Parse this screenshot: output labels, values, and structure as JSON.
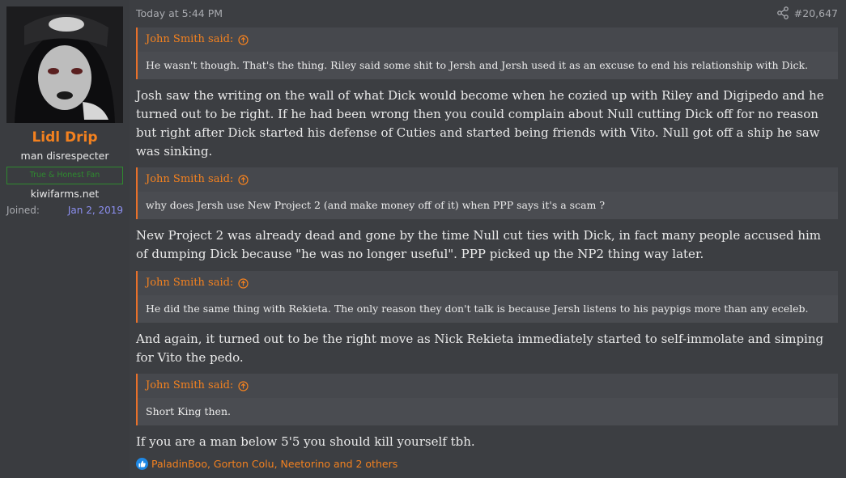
{
  "user": {
    "avatar_icon": "avatar-image",
    "name": "Lidl Drip",
    "title": "man disrespecter",
    "banner": "True & Honest Fan",
    "site": "kiwifarms.net",
    "joined_label": "Joined:",
    "joined_value": "Jan 2, 2019"
  },
  "post": {
    "timestamp": "Today at 5:44 PM",
    "share_icon": "share-icon",
    "number": "#20,647",
    "quotes": [
      {
        "author": "John Smith said:",
        "text": "He wasn't though. That's the thing. Riley said some shit to Jersh and Jersh used it as an excuse to end his relationship with Dick."
      },
      {
        "author": "John Smith said:",
        "text": "why does Jersh use New Project 2 (and make money off of it) when PPP says it's a scam ?"
      },
      {
        "author": "John Smith said:",
        "text": "He did the same thing with Rekieta. The only reason they don't talk is because Jersh listens to his paypigs more than any eceleb."
      },
      {
        "author": "John Smith said:",
        "text": "Short King then."
      }
    ],
    "paragraphs": [
      "Josh saw the writing on the wall of what Dick would become when he cozied up with Riley and Digipedo and he turned out to be right. If he had been wrong then you could complain about Null cutting Dick off for no reason but right after Dick started his defense of Cuties and started being friends with Vito. Null got off a ship he saw was sinking.",
      "New Project 2 was already dead and gone by the time Null cut ties with Dick, in fact many people accused him of dumping Dick because \"he was no longer useful\". PPP picked up the NP2 thing way later.",
      "And again, it turned out to be the right move as Nick Rekieta immediately started to self-immolate and simping for Vito the pedo.",
      "If you are a man below 5'5 you should kill yourself tbh."
    ],
    "reactions": "PaladinBoo, Gorton Colu, Neetorino and 2 others",
    "reaction_icon": "like-icon"
  },
  "colors": {
    "accent": "#f3811f",
    "background": "#3c3e42",
    "quote_background": "#46484d",
    "banner_green": "#2f8a2f",
    "date_purple": "#8c8ff0"
  }
}
